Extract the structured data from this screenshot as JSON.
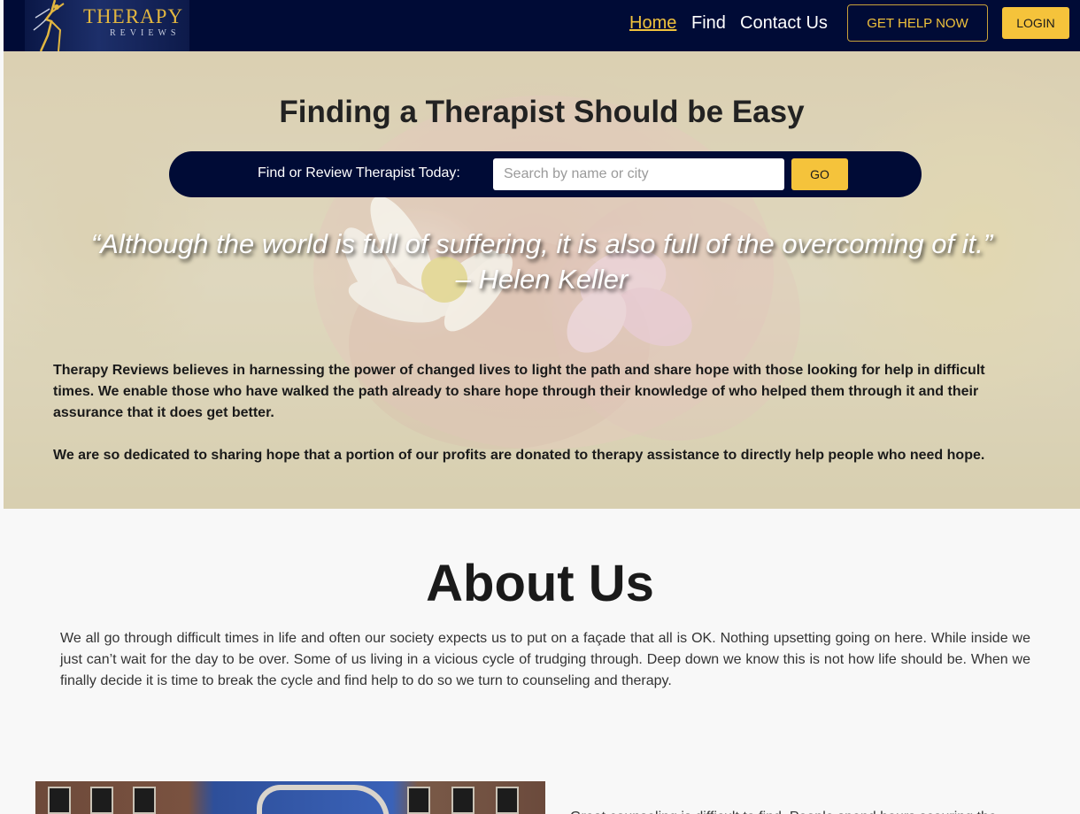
{
  "logo": {
    "main": "THERAPY",
    "sub": "REVIEWS"
  },
  "nav": {
    "links": [
      {
        "label": "Home"
      },
      {
        "label": "Find"
      },
      {
        "label": "Contact Us"
      }
    ],
    "help_button": "GET HELP NOW",
    "login_button": "LOGIN"
  },
  "hero": {
    "title": "Finding a Therapist Should be Easy",
    "search": {
      "label": "Find or Review Therapist Today:",
      "placeholder": "Search by name or city",
      "button": "GO"
    },
    "quote": {
      "text": "“Although the world is full of suffering, it is also full of the overcoming of it.”",
      "author": "– Helen Keller"
    },
    "mission": [
      "Therapy Reviews believes in harnessing the power of changed lives to light the path and share hope with those looking for help in difficult times. We enable those who have walked the path already to share hope through their knowledge of who helped them through it and their assurance that it does get better.",
      "We are so dedicated to sharing hope that a portion of our profits are donated to therapy assistance to directly help people who need hope."
    ]
  },
  "about": {
    "title": "About Us",
    "text": "We all go through difficult times in life and often our society expects us to put on a façade that all is OK. Nothing upsetting going on here. While inside we just can’t wait for the day to be over. Some of us living in a vicious cycle of trudging through. Deep down we know this is not how life should be. When we finally decide it is time to break the cycle and find help to do so we turn to counseling and therapy.",
    "bottom_text": "Great counseling is difficult to find. People spend hours scouring the"
  },
  "colors": {
    "navy": "#000b36",
    "gold": "#f5c33b"
  }
}
